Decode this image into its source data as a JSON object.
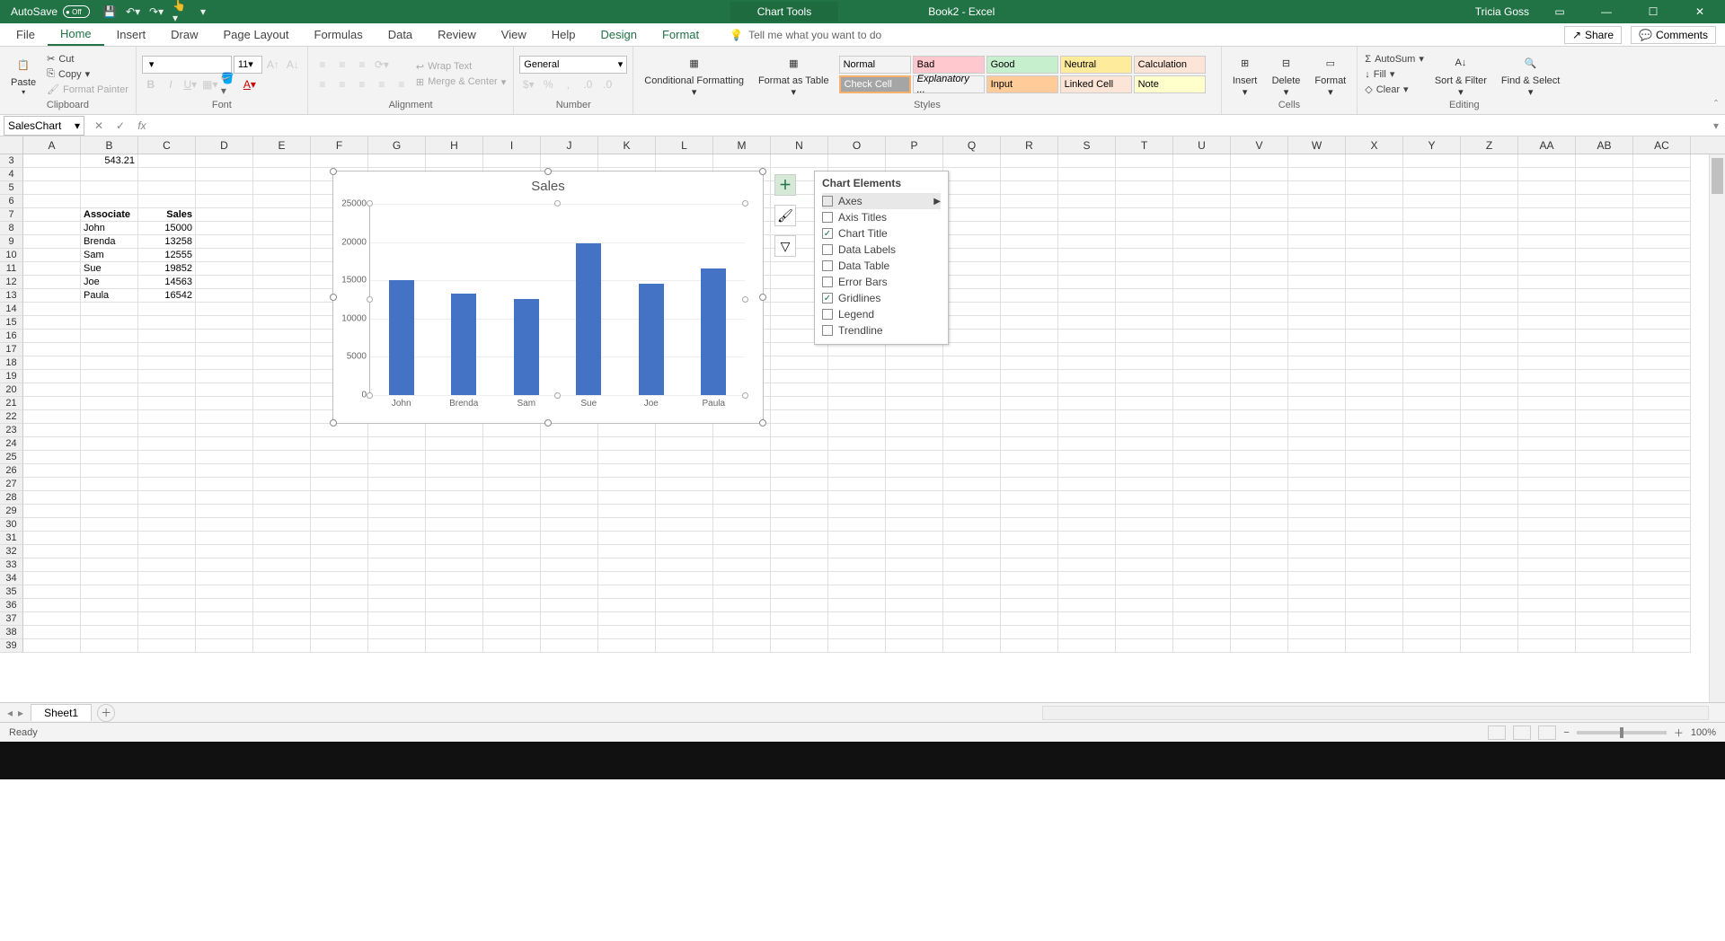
{
  "titlebar": {
    "autosave": "AutoSave",
    "autosave_state": "Off",
    "chart_tools": "Chart Tools",
    "doc_title": "Book2 - Excel",
    "user": "Tricia Goss"
  },
  "tabs": {
    "file": "File",
    "home": "Home",
    "insert": "Insert",
    "draw": "Draw",
    "pagelayout": "Page Layout",
    "formulas": "Formulas",
    "data": "Data",
    "review": "Review",
    "view": "View",
    "help": "Help",
    "design": "Design",
    "format": "Format",
    "tellme": "Tell me what you want to do",
    "share": "Share",
    "comments": "Comments"
  },
  "ribbon": {
    "clipboard": {
      "paste": "Paste",
      "cut": "Cut",
      "copy": "Copy",
      "fp": "Format Painter",
      "label": "Clipboard"
    },
    "font": {
      "size": "11",
      "label": "Font"
    },
    "alignment": {
      "wrap": "Wrap Text",
      "merge": "Merge & Center",
      "label": "Alignment"
    },
    "number": {
      "general": "General",
      "label": "Number"
    },
    "styles": {
      "cf": "Conditional Formatting",
      "fat": "Format as Table",
      "cells": [
        "Normal",
        "Bad",
        "Good",
        "Neutral",
        "Calculation",
        "Check Cell",
        "Explanatory ...",
        "Input",
        "Linked Cell",
        "Note"
      ],
      "label": "Styles"
    },
    "cells": {
      "insert": "Insert",
      "delete": "Delete",
      "format": "Format",
      "label": "Cells"
    },
    "editing": {
      "autosum": "AutoSum",
      "fill": "Fill",
      "clear": "Clear",
      "sort": "Sort & Filter",
      "find": "Find & Select",
      "label": "Editing"
    }
  },
  "namebox": "SalesChart",
  "columns": [
    "A",
    "B",
    "C",
    "D",
    "E",
    "F",
    "G",
    "H",
    "I",
    "J",
    "K",
    "L",
    "M",
    "N",
    "O",
    "P",
    "Q",
    "R",
    "S",
    "T",
    "U",
    "V",
    "W",
    "X",
    "Y",
    "Z",
    "AA",
    "AB",
    "AC"
  ],
  "start_row": 3,
  "row_count": 37,
  "cells": {
    "B3": "543.21",
    "B7": "Associate",
    "C7": "Sales",
    "B8": "John",
    "C8": "15000",
    "B9": "Brenda",
    "C9": "13258",
    "B10": "Sam",
    "C10": "12555",
    "B11": "Sue",
    "C11": "19852",
    "B12": "Joe",
    "C12": "14563",
    "B13": "Paula",
    "C13": "16542"
  },
  "chart_data": {
    "type": "bar",
    "title": "Sales",
    "categories": [
      "John",
      "Brenda",
      "Sam",
      "Sue",
      "Joe",
      "Paula"
    ],
    "values": [
      15000,
      13258,
      12555,
      19852,
      14563,
      16542
    ],
    "ylim": [
      0,
      25000
    ],
    "yticks": [
      0,
      5000,
      10000,
      15000,
      20000,
      25000
    ]
  },
  "chart_elements": {
    "title": "Chart Elements",
    "items": [
      {
        "label": "Axes",
        "checked": false,
        "hl": true,
        "arrow": true
      },
      {
        "label": "Axis Titles",
        "checked": false
      },
      {
        "label": "Chart Title",
        "checked": true
      },
      {
        "label": "Data Labels",
        "checked": false
      },
      {
        "label": "Data Table",
        "checked": false
      },
      {
        "label": "Error Bars",
        "checked": false
      },
      {
        "label": "Gridlines",
        "checked": true
      },
      {
        "label": "Legend",
        "checked": false
      },
      {
        "label": "Trendline",
        "checked": false
      }
    ]
  },
  "sheet": "Sheet1",
  "status": "Ready",
  "zoom": "100%"
}
